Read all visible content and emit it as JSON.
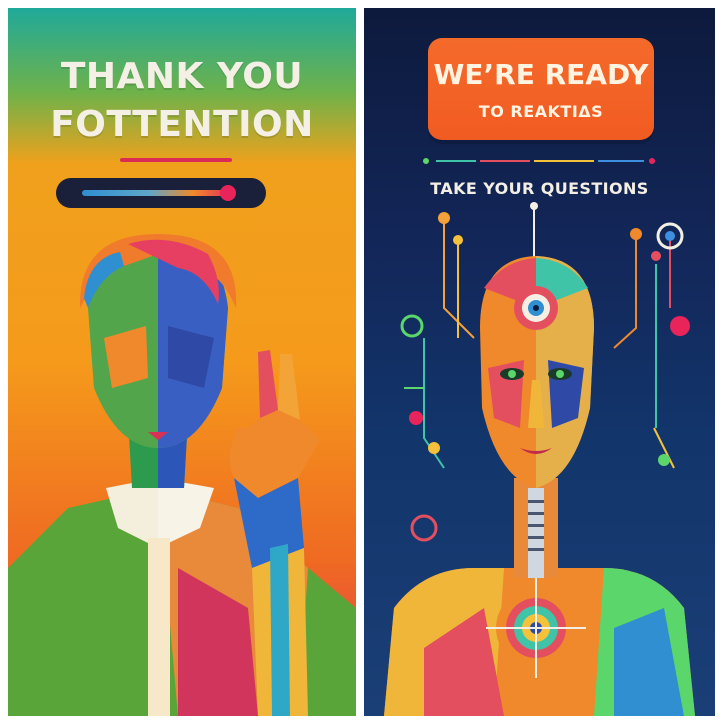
{
  "left_panel": {
    "headline_line1": "THANK YOU",
    "headline_line2": "FOTTENTION"
  },
  "right_panel": {
    "button_line1": "WE’RE READY",
    "button_line2": "TO REAKTIΔS",
    "subtitle": "TAKE YOUR QUESTIONS"
  },
  "colors": {
    "accent_orange": "#f15b22",
    "accent_magenta": "#e8245b",
    "navy": "#12275a",
    "teal": "#1fa99a"
  }
}
